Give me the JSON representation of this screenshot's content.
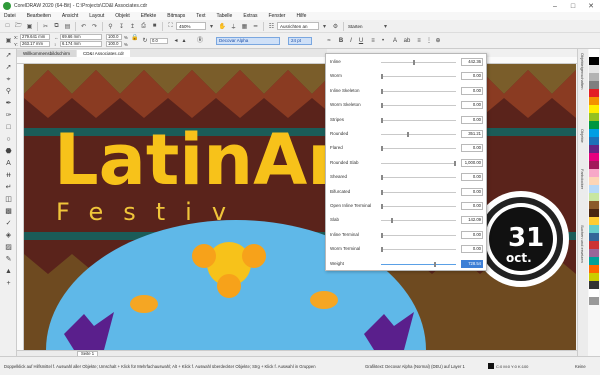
{
  "window": {
    "title": "CorelDRAW 2020 (64-Bit) - C:\\Projects\\CD&I Associates.cdr",
    "minimize": "–",
    "maximize": "□",
    "close": "✕"
  },
  "menu": [
    "Datei",
    "Bearbeiten",
    "Ansicht",
    "Layout",
    "Objekt",
    "Effekte",
    "Bitmaps",
    "Text",
    "Tabelle",
    "Extras",
    "Fenster",
    "Hilfe"
  ],
  "toolbar": {
    "zoom": "450%",
    "snap_to": "Ausrichten an",
    "launch": "Starten"
  },
  "propbar": {
    "x_label": "X:",
    "x_value": "279.641 mm",
    "y_label": "Y:",
    "y_value": "263.17 mm",
    "w_value": "69.66 mm",
    "h_value": "6.174 mm",
    "scale_w": "100.0",
    "scale_h": "100.0",
    "pct": "%",
    "angle": "0.0",
    "font_name": "Decovar Alpha",
    "font_size": "24 pt"
  },
  "document_tabs": [
    "Willkommensbildschirm",
    "CD&I Associates.cdr"
  ],
  "page_tab": "Seite 1",
  "variable_axes": [
    {
      "name": "Inline",
      "value": "442.36",
      "level": 0.44
    },
    {
      "name": "Worm",
      "value": "0.00",
      "level": 0
    },
    {
      "name": "Inline Skeleton",
      "value": "0.00",
      "level": 0
    },
    {
      "name": "Worm Skeleton",
      "value": "0.00",
      "level": 0
    },
    {
      "name": "Stripes",
      "value": "0.00",
      "level": 0
    },
    {
      "name": "Rounded",
      "value": "351.21",
      "level": 0.35
    },
    {
      "name": "Flared",
      "value": "0.00",
      "level": 0
    },
    {
      "name": "Rounded Slab",
      "value": "1,000.00",
      "level": 1.0
    },
    {
      "name": "Sheared",
      "value": "0.00",
      "level": 0
    },
    {
      "name": "Bifurcated",
      "value": "0.00",
      "level": 0
    },
    {
      "name": "Open Inline Terminal",
      "value": "0.00",
      "level": 0
    },
    {
      "name": "Slab",
      "value": "142.09",
      "level": 0.14
    },
    {
      "name": "Inline Terminal",
      "value": "0.00",
      "level": 0
    },
    {
      "name": "Worm Terminal",
      "value": "0.00",
      "level": 0
    },
    {
      "name": "Weight",
      "value": "728.54",
      "level": 0.73,
      "selected": true
    }
  ],
  "artwork": {
    "headline": "LatinArt",
    "subtitle": "Festiv",
    "date_day": "31",
    "date_month": "oct."
  },
  "status": {
    "hint": "Doppelklick auf Hilfsmittel f. Auswahl aller Objekte; Umschalt + Klick für Mehrfachauswahl; Alt + Klick f. Auswahl überdeckter Objekte; Strg + Klick f. Auswahl in Gruppen",
    "object_info": "Grafiktext: Decovar Alpha (Normal) (DEU) auf Layer 1",
    "fill": "C:0 M:0 Y:0 K:100",
    "outline": "Keine"
  },
  "dockers": [
    "Objekteigenschaften",
    "Objekte",
    "Farbdocker",
    "Suchen und ersetzen"
  ],
  "palette_colors": [
    "#ffffff",
    "#000000",
    "#e5e5e5",
    "#b3b3b3",
    "#7f7f7f",
    "#e31e24",
    "#f39200",
    "#ffed00",
    "#95c11f",
    "#009640",
    "#009ee3",
    "#1d71b8",
    "#662483",
    "#e6007e",
    "#a3195b",
    "#f7a8c8",
    "#fcd5b5",
    "#b5d8f7",
    "#c8e6a0",
    "#8b5a2b",
    "#4a2511",
    "#ffcc33",
    "#66cccc",
    "#336699",
    "#cc3333",
    "#996699",
    "#00a19a",
    "#ff6600",
    "#cccc00",
    "#333333",
    "#ffffff",
    "#999999"
  ]
}
